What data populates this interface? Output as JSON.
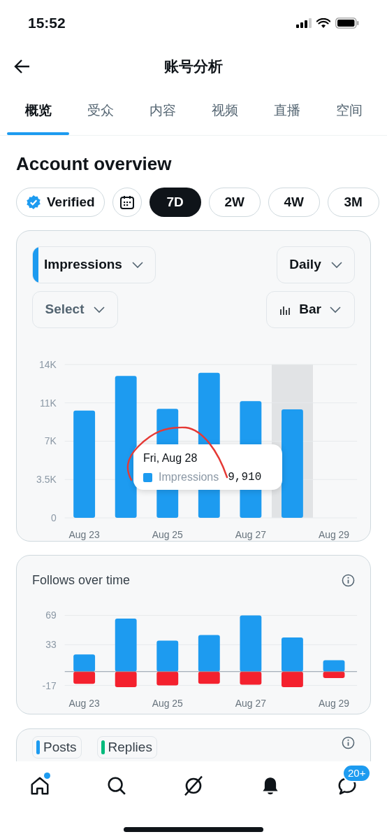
{
  "status_bar": {
    "time": "15:52"
  },
  "header": {
    "title": "账号分析"
  },
  "tabs": [
    {
      "label": "概览",
      "selected": true
    },
    {
      "label": "受众",
      "selected": false
    },
    {
      "label": "内容",
      "selected": false
    },
    {
      "label": "视频",
      "selected": false
    },
    {
      "label": "直播",
      "selected": false
    },
    {
      "label": "空间",
      "selected": false
    }
  ],
  "page_title": "Account overview",
  "filters": [
    {
      "kind": "badge",
      "label": "Verified"
    },
    {
      "kind": "calendar"
    },
    {
      "kind": "range",
      "label": "7D",
      "selected": true
    },
    {
      "kind": "range",
      "label": "2W",
      "selected": false
    },
    {
      "kind": "range",
      "label": "4W",
      "selected": false
    },
    {
      "kind": "range",
      "label": "3M",
      "selected": false
    }
  ],
  "impressions_card": {
    "metric": {
      "label": "Impressions"
    },
    "interval": {
      "label": "Daily"
    },
    "compare": {
      "placeholder": "Select"
    },
    "chart_type": {
      "label": "Bar"
    },
    "tooltip": {
      "date": "Fri, Aug 28",
      "value": "9,910"
    },
    "hover_columns": [
      {
        "highlighted": false
      },
      {
        "highlighted": false
      },
      {
        "highlighted": false
      },
      {
        "highlighted": false
      },
      {
        "highlighted": false
      },
      {
        "highlighted": true
      },
      {
        "highlighted": false
      }
    ],
    "chart_data": {
      "type": "bar",
      "grid": true,
      "categories": [
        "Aug 23",
        null,
        "Aug 25",
        null,
        "Aug 27",
        null,
        "Aug 29"
      ],
      "ylim": [
        0,
        14000
      ],
      "yticks": [
        {
          "value": 0,
          "label": "0"
        },
        {
          "value": 3500,
          "label": "3.5K"
        },
        {
          "value": 7000,
          "label": "7K"
        },
        {
          "value": 10500,
          "label": "11K"
        },
        {
          "value": 14000,
          "label": "14K"
        }
      ],
      "series": [
        {
          "name": "Impressions",
          "color": "#1d9bf0",
          "values": [
            9800,
            12950,
            9950,
            13250,
            10650,
            9910,
            null
          ]
        }
      ]
    }
  },
  "follows_card": {
    "title": "Follows over time",
    "chart_data": {
      "type": "bar",
      "grid": true,
      "stacked": true,
      "categories": [
        "Aug 23",
        null,
        "Aug 25",
        null,
        "Aug 27",
        null,
        "Aug 29"
      ],
      "ylim": [
        -20,
        69
      ],
      "yticks": [
        {
          "value": -17,
          "label": "-17"
        },
        {
          "value": 33,
          "label": "33"
        },
        {
          "value": 69,
          "label": "69"
        }
      ],
      "series": [
        {
          "color": "#1d9bf0",
          "values": [
            21,
            65,
            38,
            45,
            69,
            42,
            14
          ]
        },
        {
          "color": "#f4212e",
          "values": [
            -15,
            -19,
            -17,
            -15,
            -16,
            -19,
            -8
          ]
        }
      ]
    }
  },
  "posts_card": {
    "legend": [
      {
        "label": "Posts",
        "color": "#1d9bf0"
      },
      {
        "label": "Replies",
        "color": "#00ba7c"
      }
    ]
  },
  "nav": [
    {
      "kind": "home",
      "dot": true
    },
    {
      "kind": "search",
      "dot": false
    },
    {
      "kind": "explore",
      "dot": false
    },
    {
      "kind": "bell",
      "dot": false
    },
    {
      "kind": "messages",
      "dot": false,
      "badge": "20+"
    }
  ]
}
